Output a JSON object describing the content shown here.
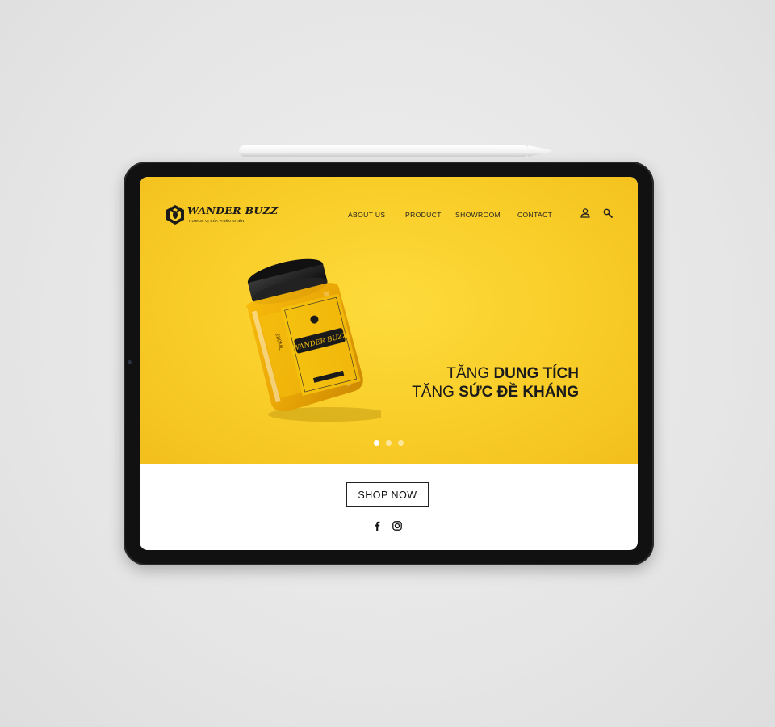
{
  "brand": {
    "name": "WANDER BUZZ",
    "tagline": "HƯƠNG VỊ CỦA THIÊN NHIÊN"
  },
  "nav": {
    "items": [
      {
        "label": "ABOUT US"
      },
      {
        "label": "PRODUCT"
      },
      {
        "label": "SHOWROOM"
      },
      {
        "label": "CONTACT"
      }
    ],
    "account_icon": "user-icon",
    "search_icon": "search-icon"
  },
  "hero": {
    "line1_regular": "TĂNG ",
    "line1_bold": "DUNG TÍCH",
    "line2_regular": "TĂNG ",
    "line2_bold": "SỨC ĐỀ KHÁNG",
    "slides_total": 3,
    "active_slide": 1,
    "background": "#f9cd28"
  },
  "jar_label": {
    "brand": "WANDER BUZZ",
    "side_text": "280ML"
  },
  "cta": {
    "label": "SHOP NOW"
  },
  "social": [
    {
      "icon": "facebook-icon"
    },
    {
      "icon": "instagram-icon"
    }
  ]
}
